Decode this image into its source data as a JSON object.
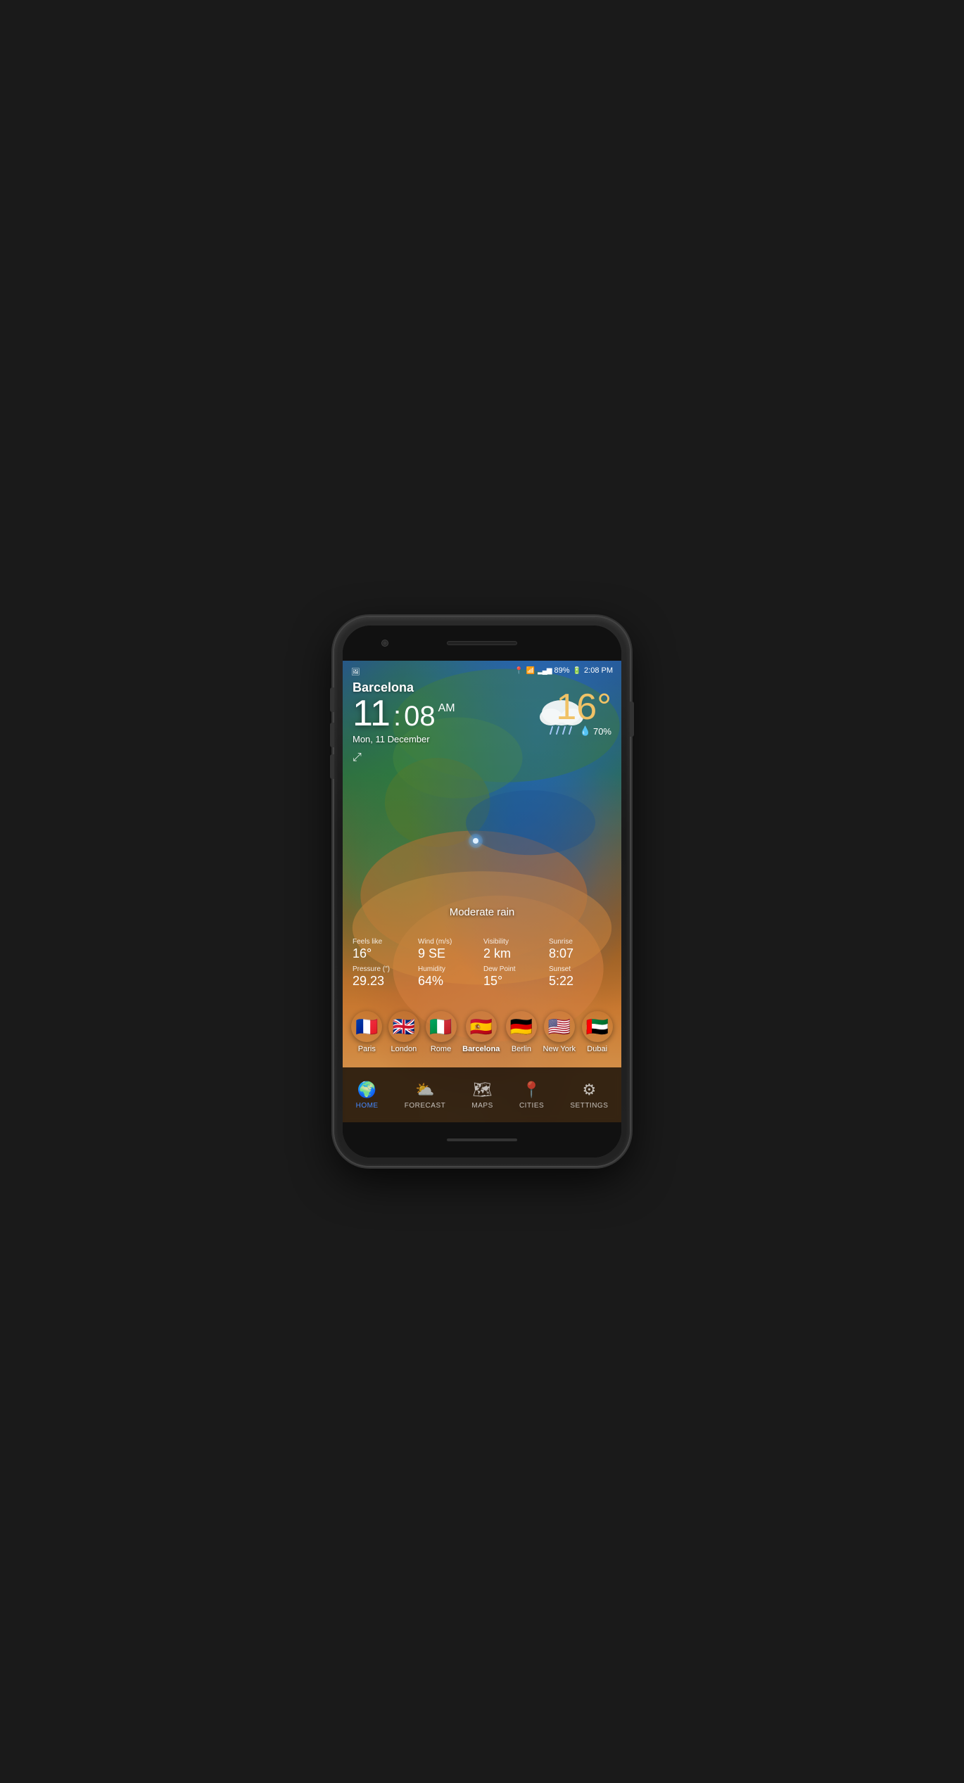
{
  "phone": {
    "status_bar": {
      "battery": "89%",
      "time": "2:08 PM",
      "signal_bars": "▂▄▆",
      "wifi": "WiFi",
      "location": "📍"
    },
    "weather": {
      "city": "Barcelona",
      "time_hour": "11",
      "time_minutes": "08",
      "time_ampm": "AM",
      "date": "Mon, 11 December",
      "temperature": "16°",
      "humidity_pct": "70%",
      "condition": "Moderate rain",
      "feels_like_label": "Feels like",
      "feels_like_value": "16°",
      "wind_label": "Wind (m/s)",
      "wind_value": "9 SE",
      "visibility_label": "Visibility",
      "visibility_value": "2 km",
      "sunrise_label": "Sunrise",
      "sunrise_value": "8:07",
      "pressure_label": "Pressure (\")",
      "pressure_value": "29.23",
      "humidity_label": "Humidity",
      "humidity_value": "64%",
      "dew_point_label": "Dew Point",
      "dew_point_value": "15°",
      "sunset_label": "Sunset",
      "sunset_value": "5:22"
    },
    "cities": [
      {
        "name": "Paris",
        "flag": "🇫🇷",
        "active": false
      },
      {
        "name": "London",
        "flag": "🇬🇧",
        "active": false
      },
      {
        "name": "Rome",
        "flag": "🇮🇹",
        "active": false
      },
      {
        "name": "Barcelona",
        "flag": "🇪🇸",
        "active": true
      },
      {
        "name": "Berlin",
        "flag": "🇩🇪",
        "active": false
      },
      {
        "name": "New York",
        "flag": "🇺🇸",
        "active": false
      },
      {
        "name": "Dubai",
        "flag": "🇦🇪",
        "active": false
      }
    ],
    "nav": [
      {
        "id": "home",
        "label": "HOME",
        "icon": "🌍",
        "active": true
      },
      {
        "id": "forecast",
        "label": "FORECAST",
        "icon": "⛅",
        "active": false
      },
      {
        "id": "maps",
        "label": "MAPS",
        "icon": "🗺",
        "active": false
      },
      {
        "id": "cities",
        "label": "CITIES",
        "icon": "📍",
        "active": false
      },
      {
        "id": "settings",
        "label": "SETTINGS",
        "icon": "⚙",
        "active": false
      }
    ]
  }
}
